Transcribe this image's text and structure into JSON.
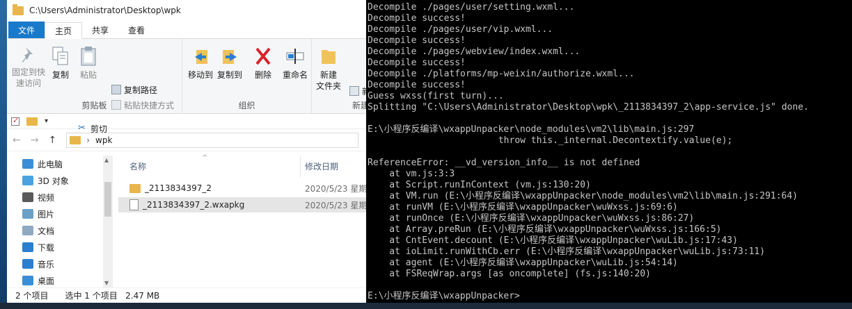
{
  "explorer": {
    "title": "C:\\Users\\Administrator\\Desktop\\wpk",
    "tabs": [
      "文件",
      "主页",
      "共享",
      "查看"
    ],
    "ribbon": {
      "pin_label": "固定到快\n速访问",
      "copy_label": "复制",
      "paste_label": "粘贴",
      "copy_path_label": "复制路径",
      "paste_shortcut_label": "粘贴快捷方式",
      "cut_label": "剪切",
      "clipboard_group": "剪贴板",
      "move_to_label": "移动到",
      "copy_to_label": "复制到",
      "delete_label": "删除",
      "rename_label": "重命名",
      "organize_group": "组织",
      "new_folder_label": "新建\n文件夹",
      "new_group": "新建",
      "new_small_label": "新"
    },
    "qat_dropdown": "▾",
    "address": {
      "back": "←",
      "forward": "→",
      "up": "↑",
      "separator": "›",
      "path": "wpk"
    },
    "nav_items": [
      {
        "label": "此电脑",
        "icon": "computer-icon",
        "color": "#3a8fd6"
      },
      {
        "label": "3D 对象",
        "icon": "cube-icon",
        "color": "#4aa3df"
      },
      {
        "label": "视频",
        "icon": "video-icon",
        "color": "#5a5a5a"
      },
      {
        "label": "图片",
        "icon": "picture-icon",
        "color": "#6aa0c8"
      },
      {
        "label": "文档",
        "icon": "document-icon",
        "color": "#8fa9c3"
      },
      {
        "label": "下载",
        "icon": "download-icon",
        "color": "#2a7fd0"
      },
      {
        "label": "音乐",
        "icon": "music-icon",
        "color": "#2a7fd0"
      },
      {
        "label": "桌面",
        "icon": "desktop-icon",
        "color": "#3a8fd6"
      }
    ],
    "columns": {
      "name": "名称",
      "modified": "修改日期"
    },
    "files": [
      {
        "name": "_2113834397_2",
        "date": "2020/5/23 星期",
        "type": "folder"
      },
      {
        "name": "_2113834397_2.wxapkg",
        "date": "2020/5/23 星期",
        "type": "file"
      }
    ],
    "status": {
      "count": "2 个项目",
      "selected": "选中 1 个项目",
      "size": "2.47 MB"
    }
  },
  "console": {
    "lines": [
      "Decompile ./pages/user/setting.wxml...",
      "Decompile success!",
      "Decompile ./pages/user/vip.wxml...",
      "Decompile success!",
      "Decompile ./pages/webview/index.wxml...",
      "Decompile success!",
      "Decompile ./platforms/mp-weixin/authorize.wxml...",
      "Decompile success!",
      "Guess wxss(first turn)...",
      "Splitting \"C:\\Users\\Administrator\\Desktop\\wpk\\_2113834397_2\\app-service.js\" done.",
      "",
      "E:\\小程序反编译\\wxappUnpacker\\node_modules\\vm2\\lib\\main.js:297",
      "                        throw this._internal.Decontextify.value(e);",
      "",
      "ReferenceError: __vd_version_info__ is not defined",
      "    at vm.js:3:3",
      "    at Script.runInContext (vm.js:130:20)",
      "    at VM.run (E:\\小程序反编译\\wxappUnpacker\\node_modules\\vm2\\lib\\main.js:291:64)",
      "    at runVM (E:\\小程序反编译\\wxappUnpacker\\wuWxss.js:69:6)",
      "    at runOnce (E:\\小程序反编译\\wxappUnpacker\\wuWxss.js:86:27)",
      "    at Array.preRun (E:\\小程序反编译\\wxappUnpacker\\wuWxss.js:166:5)",
      "    at CntEvent.decount (E:\\小程序反编译\\wxappUnpacker\\wuLib.js:17:43)",
      "    at ioLimit.runWithCb.err (E:\\小程序反编译\\wxappUnpacker\\wuLib.js:73:11)",
      "    at agent (E:\\小程序反编译\\wxappUnpacker\\wuLib.js:54:14)",
      "    at FSReqWrap.args [as oncomplete] (fs.js:140:20)",
      "",
      "E:\\小程序反编译\\wxappUnpacker>"
    ]
  }
}
